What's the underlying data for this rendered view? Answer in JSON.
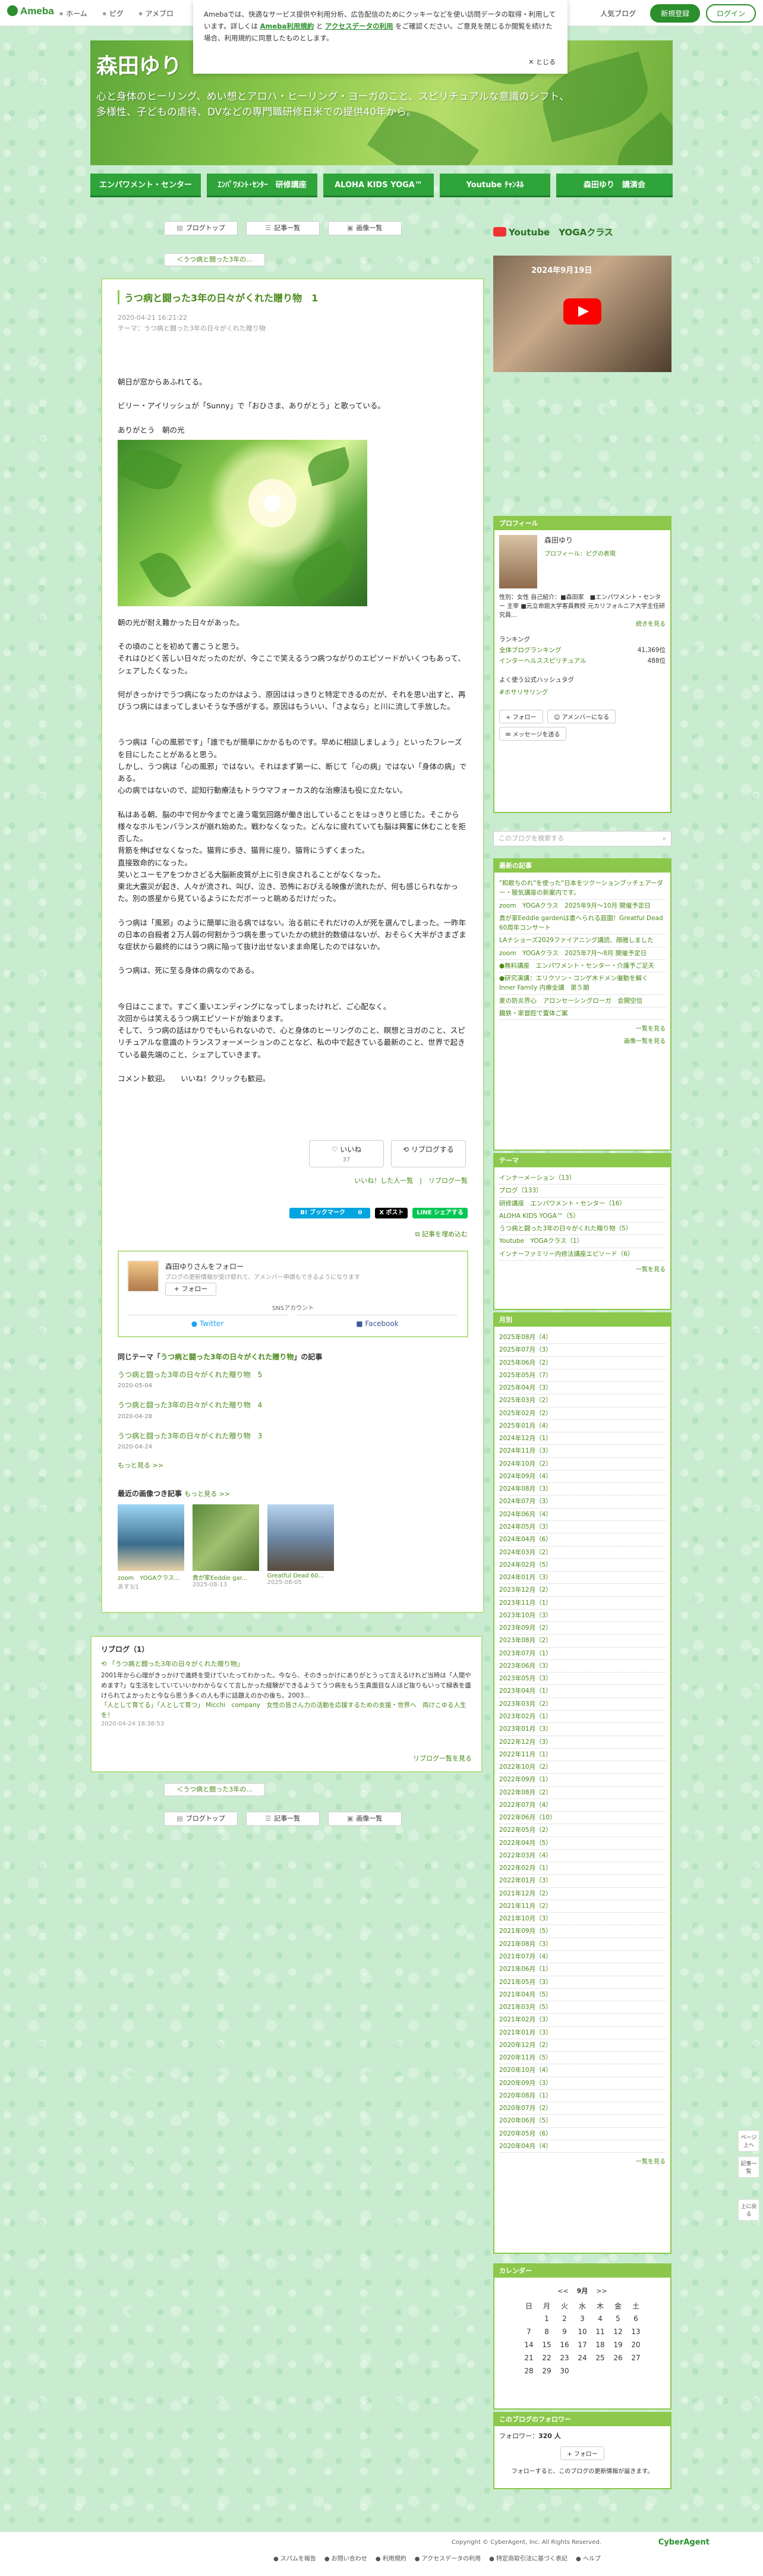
{
  "header": {
    "logo": "Ameba",
    "nav": [
      "ホーム",
      "ピグ",
      "アメブロ"
    ],
    "popular": "人気ブログ",
    "register": "新規登録",
    "login": "ログイン"
  },
  "cookie": {
    "text1": "Amebaでは、快適なサービス提供や利用分析、広告配信のためにクッキーなどを使い訪問データの取得・利用しています。詳しくは",
    "link1": "Ameba利用規約",
    "text2": "と",
    "link2": "アクセスデータの利用",
    "text3": "をご確認ください。ご意見を閉じるか閲覧を続けた場合、利用規約に同意したものとします。",
    "close": "✕ とじる"
  },
  "banner": {
    "title": "森田ゆり",
    "desc_line1": "心と身体のヒーリング、めい想とアロハ・ヒーリング・ヨーガのこと、スピリチュアルな意識のシフト、",
    "desc_line2": "多様性、子どもの虐待、DVなどの専門職研修日米での提供40年から。"
  },
  "menu": [
    "エンパワメント・センター",
    "ｴﾝﾊﾟﾜﾒﾝﾄ･ｾﾝﾀｰ　研修講座",
    "ALOHA KIDS YOGA™",
    "Youtube ﾁｬﾝﾈﾙ",
    "森田ゆり　講演会"
  ],
  "tools": {
    "blog_top": "ブログトップ",
    "articles": "記事一覧",
    "images": "画像一覧",
    "prev": "＜うつ病と闘った3年の...",
    "next": "＜うつ病と闘った3年の..."
  },
  "article": {
    "title": "うつ病と闘った3年の日々がくれた贈り物　1",
    "date": "2020-04-21 16:21:22",
    "theme": "テーマ：うつ病と闘った3年の日々がくれた贈り物",
    "p1": "朝日が窓からあふれてる。",
    "p2": "ビリー・アイリッシュが「Sunny」で「おひさま、ありがとう」と歌っている。",
    "p3": "ありがとう　朝の光",
    "p4": "朝の光が耐え難かった日々があった。",
    "p5": "その頃のことを初めて書こうと思う。",
    "p6": "それはひどく苦しい日々だったのだが、今ここで笑えるうつ病つながりのエピソードがいくつもあって、シェアしたくなった。",
    "p7": "何がきっかけでうつ病になったのかはよう、原因ははっきりと特定できるのだが、それを思い出すと、再びうつ病にはまってしまいそうな予感がする。原因はもういい、「さよなら」と川に流して手放した。",
    "p8": "うつ病は「心の風邪です」「誰でもが簡単にかかるものです。早めに相談しましょう」といったフレーズを目にしたことがあると思う。",
    "p9": "しかし、うつ病は「心の風邪」ではない。それはまず第一に、断じて「心の病」ではない「身体の病」である。",
    "p10": "心の病ではないので、認知行動療法もトラウマフォーカス的な治療法も役に立たない。",
    "p11": "私はある朝、脳の中で何か今までと違う電気回路が働き出していることをはっきりと感じた。そこから様々なホルモンバランスが崩れ始めた。戦わなくなった。どんなに疲れていても脳は興奮に休むことを拒否した。",
    "p12": "背筋を伸ばせなくなった。猫背に歩き、猫背に座り、猫背にうずくまった。",
    "p13": "直接致命的になった。",
    "p14": "笑いとユーモアをつかさどる大脳新皮質が上に引き戻されることがなくなった。",
    "p15": "東北大震災が起き、人々が流され、叫び、泣き、恐怖におびえる映像が流れたが、何も感じられなかった。別の惑星から見ているようにただボーっと眺めるだけだった。",
    "p16": "うつ病は「風邪」のように簡単に治る病ではない。治る前にそれだけの人が死を選んでしまった。一昨年の日本の自殺者２万人弱の何割かうつ病を患っていたかの統計的数値はないが、おそらく大半がさまざまな症状から最終的にはうつ病に陥って抜け出せないまま命尾したのではないか。",
    "p17": "うつ病は、死に至る身体の病なのである。",
    "p18": "今日はここまで。すごく重いエンディングになってしまったけれど、ご心配なく。",
    "p19": "次回からは笑えるうつ病エピソードが始まります。",
    "p20": "そして、うつ病の話はかりでもいられないので、心と身体のヒーリングのこと、瞑想とヨガのこと、スピリチュアルな意識のトランスフォーメーションのことなど、私の中で起きている最新のこと、世界で起きている最先端のこと、シェアしていきます。",
    "p21": "コメント歓迎。　　いいね！クリックも歓迎。"
  },
  "reactions": {
    "like": "いいね",
    "like_count": "37",
    "reblog": "リブログする",
    "links": "いいね！した人一覧　|　リブログ一覧",
    "share_hatena": "B! ブックマーク",
    "share_hatena_count": "0",
    "share_x": "X ポスト",
    "share_line": "LINE シェアする",
    "embed": "記事を埋め込む"
  },
  "followbox": {
    "name": "森田ゆりさんをフォロー",
    "sub": "ブログの更新情報が受け取れて、アメンバー申請もできるようになります",
    "follow": "フォロー",
    "sns": "SNSアカウント",
    "twitter": "Twitter",
    "facebook": "Facebook"
  },
  "sametheme": {
    "heading_pre": "同じテーマ「",
    "heading_link": "うつ病と闘った3年の日々がくれた贈り物",
    "heading_post": "」の記事",
    "items": [
      {
        "title": "うつ病と闘った3年の日々がくれた贈り物　5",
        "date": "2020-05-04"
      },
      {
        "title": "うつ病と闘った3年の日々がくれた贈り物　4",
        "date": "2020-04-28"
      },
      {
        "title": "うつ病と闘った3年の日々がくれた贈り物　3",
        "date": "2020-04-24"
      }
    ],
    "more": "もっと見る >>"
  },
  "latest": {
    "heading": "最近の画像つき記事",
    "more": "もっと見る >>",
    "items": [
      {
        "title": "zoom　YOGAクラス...",
        "date": "あす3/1"
      },
      {
        "title": "貴が家Eeddie gar...",
        "date": "2025-08-13"
      },
      {
        "title": "Greatful Dead 60...",
        "date": "2025-08-05"
      }
    ]
  },
  "reblog": {
    "heading": "リブログ（1）",
    "title": "「うつ病と闘った3年の日々がくれた贈り物」",
    "text": "2001年から心理がきっかけで進終を受けていたってわかった。今なら、そのきっかけにありがとうって言えるけれど当時は「人間やめます?」な生活をしていていいかわからなくて言しかった経験ができるようてうつ病をもう生真面目な人ほど抜りもいって緑表を盛けられてよかったと今なら思う多くの人も手に話題えのかの後ち。2003...",
    "author": "「人として育てる」「人として育つ」 Micchi　company　女性の皆さん力の活動を応援するための支援・世界へ　両けこゆる人生を！",
    "date": "2020-04-24 18:38:53",
    "more": "リブログ一覧を見る"
  },
  "sidebar": {
    "yt_title": "Youtube　YOGAクラス",
    "yt_text": "2024年9月19日",
    "profile": {
      "head": "プロフィール",
      "name": "森田ゆり",
      "link": "プロフィール：ピグの表現",
      "meta": "性別：女性\n自己紹介：■森田家　■エンパワメント・センター 主宰 ■元立命館大学客員教授 元カリフォルニア大学主任研究員...",
      "more": "続きを見る",
      "ranking": "ランキング",
      "r1_label": "全体ブログランキング",
      "r1_val": "41,369位",
      "r2_label": "インターヘルススピリチュアル",
      "r2_val": "488位",
      "hashtag_head": "よく使う公式ハッシュタグ",
      "hashtag": "#ホサリサリング",
      "follow": "フォロー",
      "amember": "アメンバーになる",
      "message": "メッセージを送る"
    },
    "search_placeholder": "このブログを検索する",
    "recent": {
      "head": "最新の記事",
      "items": [
        "\"和歌ちのれ\"を使った\"日本をツクーションブッチェアーダー・服気講座の新案内です。",
        "zoom　YOGAクラス　2025年9月〜10月 開催予定日",
        "貴が家Eeddie gardenは書へられる庭園！Greatful Dead 60周年コンサート",
        "LAナショーズ2029ファイアニング講読、顔雅しました",
        "zoom　YOGAクラス　2025年7月〜8月 開催予定日",
        "●無料講座　エンパワメント・センター・介護予ご足天",
        "●研究演講：エリクソン・コンゲ木ドメン催動を解く Inner Family 内療全講　第５期",
        "夏の防炎界心　アロンセーシングローガ　会開空信",
        "臓鉄・家督腔で置体ご案"
      ],
      "more": "一覧を見る",
      "more2": "画像一覧を見る"
    },
    "themes": {
      "head": "テーマ",
      "items": [
        "インナーメーション（13）",
        "ブログ（133）",
        "研修講座　エンパワメント・センター（16）",
        "ALOHA KIDS YOGA™（5）",
        "うつ病と闘った3年の日々がくれた贈り物（5）",
        "Youtube　YOGAクラス（1）",
        "インナーファミリー内修法講座エピソード（6）"
      ],
      "more": "一覧を見る"
    },
    "archive": {
      "head": "月別",
      "items": [
        "2025年08月（4）",
        "2025年07月（3）",
        "2025年06月（2）",
        "2025年05月（7）",
        "2025年04月（3）",
        "2025年03月（2）",
        "2025年02月（2）",
        "2025年01月（4）",
        "2024年12月（1）",
        "2024年11月（3）",
        "2024年10月（2）",
        "2024年09月（4）",
        "2024年08月（3）",
        "2024年07月（3）",
        "2024年06月（4）",
        "2024年05月（3）",
        "2024年04月（6）",
        "2024年03月（2）",
        "2024年02月（5）",
        "2024年01月（3）",
        "2023年12月（2）",
        "2023年11月（1）",
        "2023年10月（3）",
        "2023年09月（2）",
        "2023年08月（2）",
        "2023年07月（1）",
        "2023年06月（3）",
        "2023年05月（3）",
        "2023年04月（1）",
        "2023年03月（2）",
        "2023年02月（1）",
        "2023年01月（3）",
        "2022年12月（3）",
        "2022年11月（1）",
        "2022年10月（2）",
        "2022年09月（1）",
        "2022年08月（2）",
        "2022年07月（4）",
        "2022年06月（10）",
        "2022年05月（2）",
        "2022年04月（5）",
        "2022年03月（4）",
        "2022年02月（1）",
        "2022年01月（3）",
        "2021年12月（2）",
        "2021年11月（2）",
        "2021年10月（3）",
        "2021年09月（5）",
        "2021年08月（3）",
        "2021年07月（4）",
        "2021年06月（1）",
        "2021年05月（3）",
        "2021年04月（5）",
        "2021年03月（5）",
        "2021年02月（3）",
        "2021年01月（3）",
        "2020年12月（2）",
        "2020年11月（5）",
        "2020年10月（4）",
        "2020年09月（3）",
        "2020年08月（1）",
        "2020年07月（2）",
        "2020年06月（5）",
        "2020年05月（6）",
        "2020年04月（4）"
      ],
      "more": "一覧を見る"
    },
    "calendar": {
      "head": "カレンダー",
      "prev": "<<",
      "month": "9月",
      "next": ">>",
      "dow": [
        "日",
        "月",
        "火",
        "水",
        "木",
        "金",
        "土"
      ],
      "weeks": [
        [
          "",
          "1",
          "2",
          "3",
          "4",
          "5",
          "6"
        ],
        [
          "7",
          "8",
          "9",
          "10",
          "11",
          "12",
          "13"
        ],
        [
          "14",
          "15",
          "16",
          "17",
          "18",
          "19",
          "20"
        ],
        [
          "21",
          "22",
          "23",
          "24",
          "25",
          "26",
          "27"
        ],
        [
          "28",
          "29",
          "30",
          "",
          "",
          "",
          ""
        ]
      ]
    },
    "followers": {
      "head": "このブログのフォロワー",
      "label": "フォロワー：",
      "count": "320 人",
      "btn": "フォロー",
      "note": "フォローすると、このブログの更新情報が届きます。"
    }
  },
  "pagetop": {
    "top": "ページ上へ",
    "comment": "記事一覧",
    "up": "上に戻る"
  },
  "footer": {
    "copyright": "Copyright © CyberAgent, Inc. All Rights Reserved.",
    "brand": "CyberAgent",
    "links": [
      "スパムを報告",
      "お問い合わせ",
      "利用規約",
      "アクセスデータの利用",
      "特定商取引法に基づく表記",
      "ヘルプ"
    ]
  },
  "colors": {
    "accent": "#8cc84b",
    "brand": "#2b8f2b",
    "link": "#4a8a1a",
    "menu": "#2ea43a"
  }
}
